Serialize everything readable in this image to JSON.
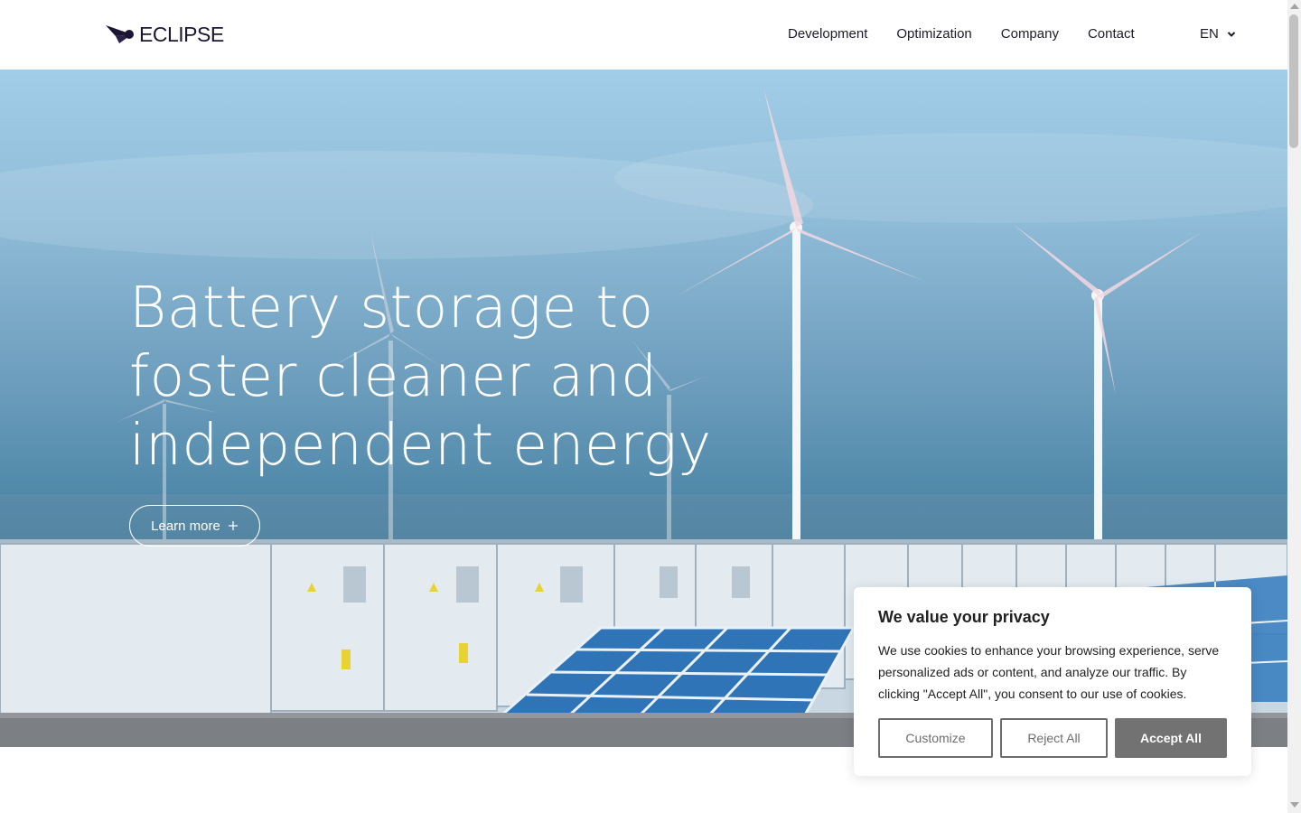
{
  "header": {
    "logo_text": "ECLIPSE",
    "nav": [
      {
        "label": "Development"
      },
      {
        "label": "Optimization"
      },
      {
        "label": "Company"
      },
      {
        "label": "Contact"
      }
    ],
    "language": "EN"
  },
  "hero": {
    "title": "Battery storage to foster cleaner and independent energy",
    "cta_label": "Learn more",
    "cta_icon": "plus-icon"
  },
  "cookie_banner": {
    "title": "We value your privacy",
    "body": "We use cookies to enhance your browsing experience, serve personalized ads or content, and analyze our traffic. By clicking \"Accept All\", you consent to our use of cookies.",
    "customize_label": "Customize",
    "reject_label": "Reject All",
    "accept_label": "Accept All"
  },
  "colors": {
    "brand": "#1c1633",
    "accept_button": "#727272",
    "outline_button": "#6d6d6d"
  }
}
